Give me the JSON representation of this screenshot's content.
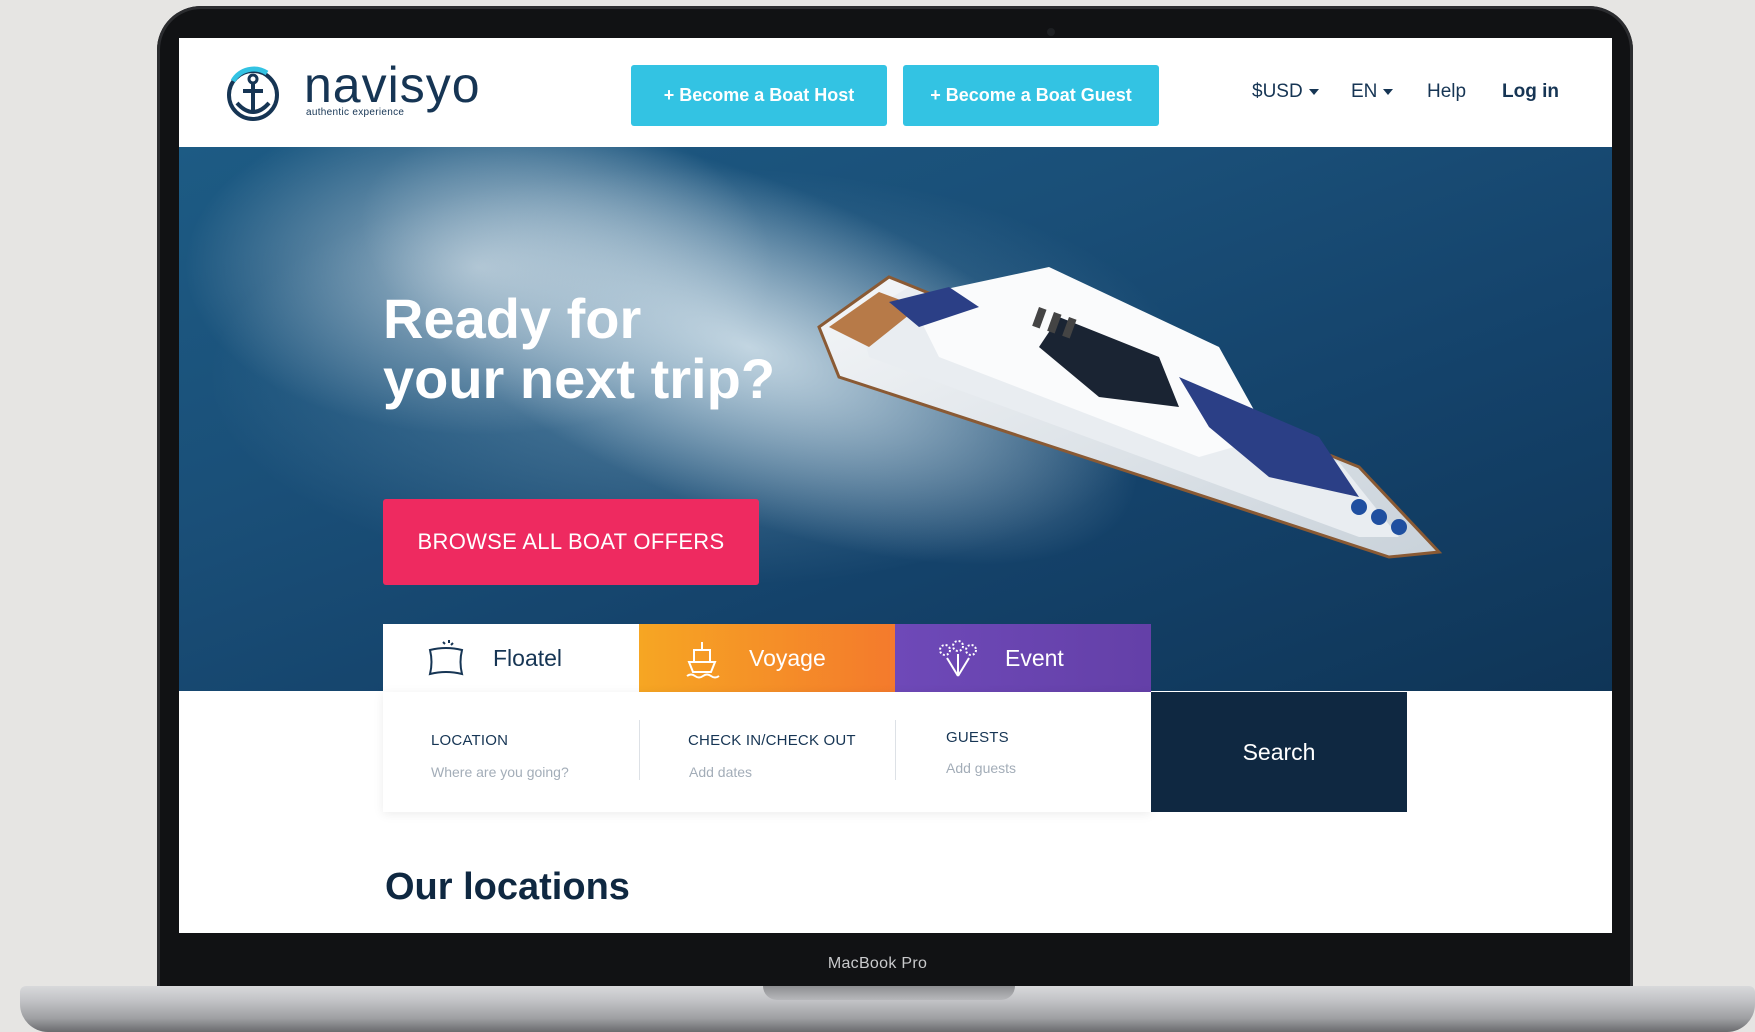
{
  "brand": {
    "name": "navisyo",
    "tagline": "authentic experience",
    "color_primary": "#163554",
    "color_accent": "#33c3e3"
  },
  "header": {
    "become_host": "+ Become a Boat Host",
    "become_guest": "+ Become a Boat Guest",
    "currency": "$USD",
    "language": "EN",
    "help": "Help",
    "login": "Log in"
  },
  "hero": {
    "title_line1": "Ready for",
    "title_line2": "your next trip?",
    "cta": "BROWSE ALL BOAT OFFERS",
    "cta_color": "#ee2a60"
  },
  "tabs": [
    {
      "label": "Floatel",
      "icon": "pillow-icon",
      "active": true
    },
    {
      "label": "Voyage",
      "icon": "ship-icon",
      "color": "#f6a623"
    },
    {
      "label": "Event",
      "icon": "fireworks-icon",
      "color": "#6e49b8"
    }
  ],
  "search": {
    "location_label": "LOCATION",
    "location_placeholder": "Where are you going?",
    "dates_label": "CHECK IN/CHECK OUT",
    "dates_placeholder": "Add dates",
    "guests_label": "GUESTS",
    "guests_placeholder": "Add guests",
    "button": "Search",
    "button_color": "#0f2841"
  },
  "sections": {
    "locations_title": "Our locations"
  },
  "device": {
    "label": "MacBook Pro"
  }
}
